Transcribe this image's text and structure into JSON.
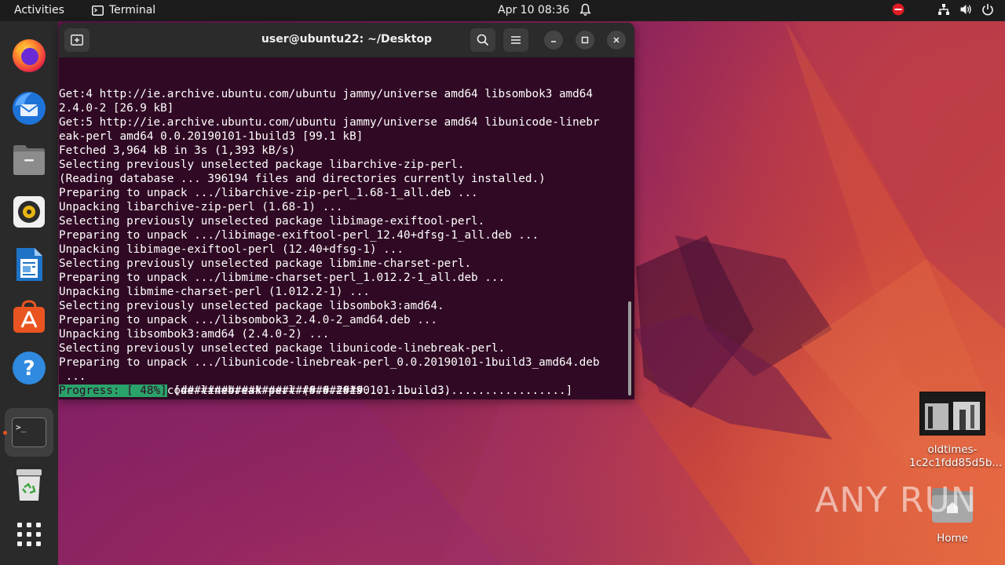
{
  "topbar": {
    "activities": "Activities",
    "app_name": "Terminal",
    "clock": "Apr 10  08:36"
  },
  "terminal": {
    "title": "user@ubuntu22: ~/Desktop",
    "lines": [
      "Get:4 http://ie.archive.ubuntu.com/ubuntu jammy/universe amd64 libsombok3 amd64",
      "2.4.0-2 [26.9 kB]",
      "Get:5 http://ie.archive.ubuntu.com/ubuntu jammy/universe amd64 libunicode-linebr",
      "eak-perl amd64 0.0.20190101-1build3 [99.1 kB]",
      "Fetched 3,964 kB in 3s (1,393 kB/s)",
      "Selecting previously unselected package libarchive-zip-perl.",
      "(Reading database ... 396194 files and directories currently installed.)",
      "Preparing to unpack .../libarchive-zip-perl_1.68-1_all.deb ...",
      "Unpacking libarchive-zip-perl (1.68-1) ...",
      "Selecting previously unselected package libimage-exiftool-perl.",
      "Preparing to unpack .../libimage-exiftool-perl_12.40+dfsg-1_all.deb ...",
      "Unpacking libimage-exiftool-perl (12.40+dfsg-1) ...",
      "Selecting previously unselected package libmime-charset-perl.",
      "Preparing to unpack .../libmime-charset-perl_1.012.2-1_all.deb ...",
      "Unpacking libmime-charset-perl (1.012.2-1) ...",
      "Selecting previously unselected package libsombok3:amd64.",
      "Preparing to unpack .../libsombok3_2.4.0-2_amd64.deb ...",
      "Unpacking libsombok3:amd64 (2.4.0-2) ...",
      "Selecting previously unselected package libunicode-linebreak-perl.",
      "Preparing to unpack .../libunicode-linebreak-perl_0.0.20190101-1build3_amd64.deb",
      " ...",
      "Unpacking libunicode-linebreak-perl (0.0.20190101-1build3) ..."
    ],
    "progress_label": "Progress: [ 48%]",
    "progress_bar": " [###########################..............................]",
    "progress_value": 0.48
  },
  "dock": {
    "items": [
      {
        "name": "firefox-icon"
      },
      {
        "name": "thunderbird-icon"
      },
      {
        "name": "files-icon"
      },
      {
        "name": "rhythmbox-icon"
      },
      {
        "name": "libreoffice-writer-icon"
      },
      {
        "name": "ubuntu-software-icon"
      },
      {
        "name": "help-icon"
      },
      {
        "name": "terminal-icon"
      },
      {
        "name": "trash-icon"
      },
      {
        "name": "show-apps-icon"
      }
    ]
  },
  "desktop": {
    "file1_name": "oldtimes-\n1c2c1fdd85d5b...",
    "file2_name": "Home",
    "watermark": "ANY RUN"
  },
  "colors": {
    "terminal_bg": "#300a24",
    "progress_green": "#2aa36a",
    "ubuntu_orange": "#e95420"
  }
}
